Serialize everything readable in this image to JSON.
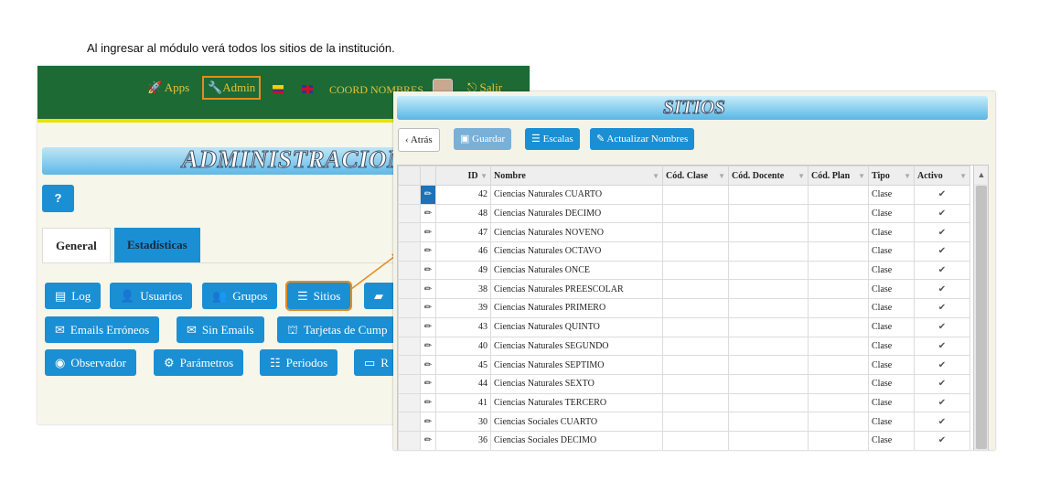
{
  "caption": "Al ingresar al módulo verá todos los sitios de la institución.",
  "admin": {
    "top": {
      "apps": "Apps",
      "admin": "Admin",
      "coord": "COORD NOMBRES",
      "logout": "Salir"
    },
    "title": "ADMINISTRACION",
    "help": "?",
    "tabs": {
      "general": "General",
      "stats": "Estadísticas"
    },
    "buttons": {
      "log": "Log",
      "usuarios": "Usuarios",
      "grupos": "Grupos",
      "sitios": "Sitios",
      "emails_err": "Emails Erróneos",
      "sin_emails": "Sin Emails",
      "tarjetas": "Tarjetas de Cump",
      "observador": "Observador",
      "parametros": "Parámetros",
      "periodos": "Periodos",
      "r": "R"
    }
  },
  "sitios": {
    "title": "SITIOS",
    "toolbar": {
      "back": "Atrás",
      "save": "Guardar",
      "scales": "Escalas",
      "update": "Actualizar Nombres"
    },
    "columns": [
      "ID",
      "Nombre",
      "Cód. Clase",
      "Cód. Docente",
      "Cód. Plan",
      "Tipo",
      "Activo"
    ],
    "rows": [
      {
        "id": "42",
        "name": "Ciencias Naturales CUARTO",
        "tipo": "Clase",
        "activo": true
      },
      {
        "id": "48",
        "name": "Ciencias Naturales DECIMO",
        "tipo": "Clase",
        "activo": true
      },
      {
        "id": "47",
        "name": "Ciencias Naturales NOVENO",
        "tipo": "Clase",
        "activo": true
      },
      {
        "id": "46",
        "name": "Ciencias Naturales OCTAVO",
        "tipo": "Clase",
        "activo": true
      },
      {
        "id": "49",
        "name": "Ciencias Naturales ONCE",
        "tipo": "Clase",
        "activo": true
      },
      {
        "id": "38",
        "name": "Ciencias Naturales PREESCOLAR",
        "tipo": "Clase",
        "activo": true
      },
      {
        "id": "39",
        "name": "Ciencias Naturales PRIMERO",
        "tipo": "Clase",
        "activo": true
      },
      {
        "id": "43",
        "name": "Ciencias Naturales QUINTO",
        "tipo": "Clase",
        "activo": true
      },
      {
        "id": "40",
        "name": "Ciencias Naturales SEGUNDO",
        "tipo": "Clase",
        "activo": true
      },
      {
        "id": "45",
        "name": "Ciencias Naturales SEPTIMO",
        "tipo": "Clase",
        "activo": true
      },
      {
        "id": "44",
        "name": "Ciencias Naturales SEXTO",
        "tipo": "Clase",
        "activo": true
      },
      {
        "id": "41",
        "name": "Ciencias Naturales TERCERO",
        "tipo": "Clase",
        "activo": true
      },
      {
        "id": "30",
        "name": "Ciencias Sociales CUARTO",
        "tipo": "Clase",
        "activo": true
      },
      {
        "id": "36",
        "name": "Ciencias Sociales DECIMO",
        "tipo": "Clase",
        "activo": true
      }
    ]
  },
  "colors": {
    "header_green": "#1d6a34",
    "accent_blue": "#1b8fd4",
    "highlight_orange": "#e58b22"
  }
}
